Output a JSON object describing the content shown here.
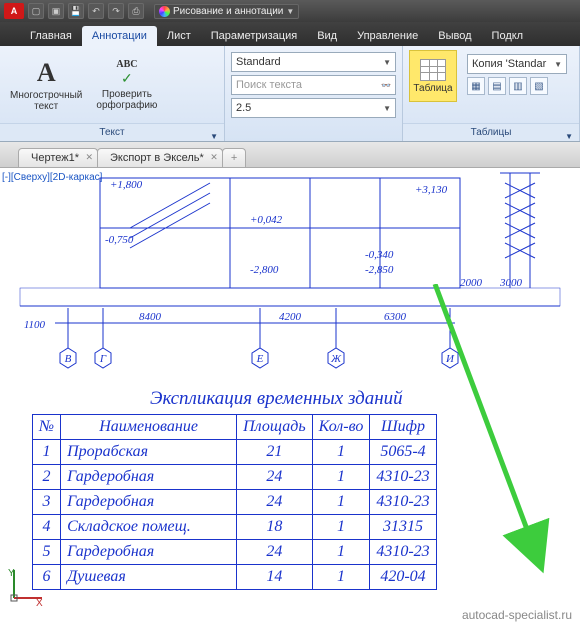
{
  "workspace": {
    "label": "Рисование и аннотации"
  },
  "tabs": [
    "Главная",
    "Аннотации",
    "Лист",
    "Параметризация",
    "Вид",
    "Управление",
    "Вывод",
    "Подкл"
  ],
  "active_tab": 1,
  "ribbon": {
    "mtext": {
      "label": "Многострочный\nтекст"
    },
    "spell": {
      "abc": "ABC",
      "label": "Проверить\nорфографию"
    },
    "style_combo": "Standard",
    "search_placeholder": "Поиск текста",
    "height_combo": "2.5",
    "panel_text": "Текст",
    "table_btn": "Таблица",
    "copy_style": "Копия 'Standar",
    "panel_tables": "Таблицы"
  },
  "doctabs": [
    "Чертеж1*",
    "Экспорт в Эксель*"
  ],
  "view_label": "[-][Сверху][2D-каркас]",
  "drawing": {
    "dims": {
      "d1": "+1,800",
      "d2": "-0,750",
      "d3": "+0,042",
      "d4": "+3,130",
      "d5": "-2,800",
      "d6": "-0,340",
      "d7": "-2,850",
      "d8": "2000",
      "d9": "3000",
      "s1": "1100",
      "s2": "8400",
      "s3": "4200",
      "s4": "6300"
    },
    "axes": [
      "В",
      "Г",
      "Е",
      "Ж",
      "И"
    ]
  },
  "table_title": "Экспликация временных зданий",
  "columns": [
    "№",
    "Наименование",
    "Площадь",
    "Кол-во",
    "Шифр"
  ],
  "rows": [
    {
      "n": "1",
      "name": "Прорабская",
      "area": "21",
      "qty": "1",
      "code": "5065-4"
    },
    {
      "n": "2",
      "name": "Гардеробная",
      "area": "24",
      "qty": "1",
      "code": "4310-23"
    },
    {
      "n": "3",
      "name": "Гардеробная",
      "area": "24",
      "qty": "1",
      "code": "4310-23"
    },
    {
      "n": "4",
      "name": "Складское помещ.",
      "area": "18",
      "qty": "1",
      "code": "31315"
    },
    {
      "n": "5",
      "name": "Гардеробная",
      "area": "24",
      "qty": "1",
      "code": "4310-23"
    },
    {
      "n": "6",
      "name": "Душевая",
      "area": "14",
      "qty": "1",
      "code": "420-04"
    }
  ],
  "watermark": "autocad-specialist.ru",
  "ucs": {
    "y": "Y",
    "x": "X"
  }
}
